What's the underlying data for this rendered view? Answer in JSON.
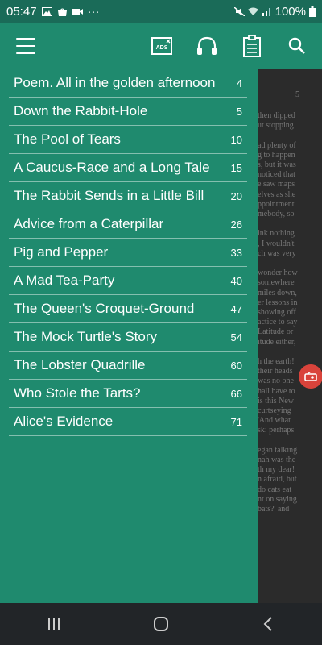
{
  "status_bar": {
    "time": "05:47",
    "more": "···",
    "battery": "100%"
  },
  "toc": [
    {
      "title": "Poem. All in the golden afternoon",
      "page": "4"
    },
    {
      "title": "Down the Rabbit-Hole",
      "page": "5"
    },
    {
      "title": "The Pool of Tears",
      "page": "10"
    },
    {
      "title": "A Caucus-Race and a Long Tale",
      "page": "15"
    },
    {
      "title": "The Rabbit Sends in a Little Bill",
      "page": "20"
    },
    {
      "title": "Advice from a Caterpillar",
      "page": "26"
    },
    {
      "title": "Pig and Pepper",
      "page": "33"
    },
    {
      "title": "A Mad Tea-Party",
      "page": "40"
    },
    {
      "title": "The Queen's Croquet-Ground",
      "page": "47"
    },
    {
      "title": "The Mock Turtle's Story",
      "page": "54"
    },
    {
      "title": "The Lobster Quadrille",
      "page": "60"
    },
    {
      "title": "Who Stole the Tarts?",
      "page": "66"
    },
    {
      "title": "Alice's Evidence",
      "page": "71"
    }
  ],
  "book_page": {
    "page_number": "5",
    "lines": [
      "then dipped",
      "ut stopping",
      "",
      "ad plenty of",
      "g to happen",
      "s, but it was",
      "noticed that",
      "e saw maps",
      "elves as she",
      "ppointment",
      "mebody, so",
      "",
      "ink nothing",
      ", I wouldn't",
      "ch was very",
      "",
      "wonder how",
      "somewhere",
      "miles down,",
      "er lessons in",
      "showing off",
      "actice to say",
      "Latitude or",
      "itude either,",
      "",
      "h the earth!",
      "their heads",
      "was no one",
      "hall have to",
      "is this New",
      "curtseying",
      "'And what",
      "sk: perhaps",
      "",
      "egan talking",
      "nah was the",
      "th my dear!",
      "n afraid, but",
      "do cats eat",
      "nt on saying",
      "bats?' and"
    ]
  },
  "icons": {
    "menu": "menu-icon",
    "ads": "ads-icon",
    "audio": "headphones-icon",
    "notes": "clipboard-icon",
    "search": "search-icon"
  },
  "ads_label": "ADS",
  "colors": {
    "primary": "#1f8a6e",
    "status_bar": "#1a6b58",
    "float_badge": "#d9433b"
  }
}
